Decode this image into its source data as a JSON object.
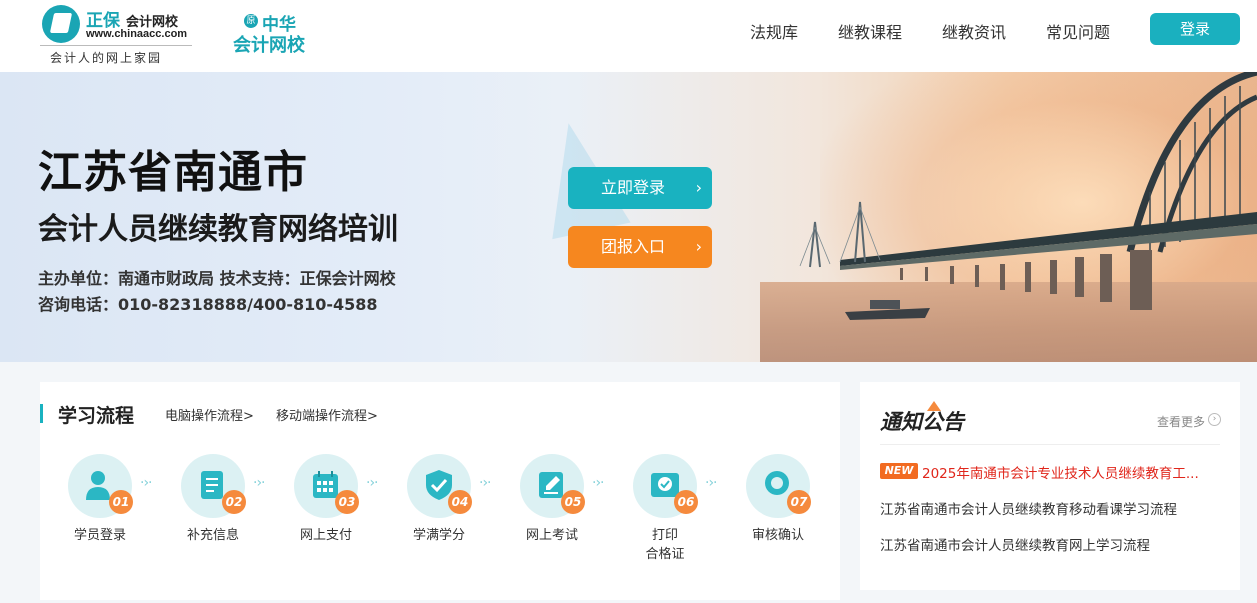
{
  "header": {
    "logo1": {
      "brand": "正保",
      "name": "会计网校",
      "url": "www.chinaacc.com",
      "slogan": "会计人的网上家园"
    },
    "logo2": {
      "badge": "原",
      "line1": "中华",
      "line2": "会计网校"
    },
    "nav": [
      "法规库",
      "继教课程",
      "继教资讯",
      "常见问题"
    ],
    "login_label": "登录"
  },
  "banner": {
    "title": "江苏省南通市",
    "subtitle": "会计人员继续教育网络培训",
    "organizer": "主办单位：南通市财政局  技术支持：正保会计网校",
    "hotline": "咨询电话：010-82318888/400-810-4588",
    "btn_login": "立即登录",
    "btn_group": "团报入口",
    "arrow": "›"
  },
  "process": {
    "title": "学习流程",
    "links": [
      "电脑操作流程>",
      "移动端操作流程>"
    ],
    "arrow": "·›·",
    "steps": [
      {
        "num": "01",
        "label": "学员登录",
        "icon": "user-icon"
      },
      {
        "num": "02",
        "label": "补充信息",
        "icon": "document-icon"
      },
      {
        "num": "03",
        "label": "网上支付",
        "icon": "calendar-icon"
      },
      {
        "num": "04",
        "label": "学满学分",
        "icon": "shield-check-icon"
      },
      {
        "num": "05",
        "label": "网上考试",
        "icon": "edit-icon"
      },
      {
        "num": "06",
        "label": "打印\n合格证",
        "icon": "certificate-icon"
      },
      {
        "num": "07",
        "label": "审核确认",
        "icon": "search-icon"
      }
    ]
  },
  "notice": {
    "title": "通知公告",
    "more": "查看更多",
    "new_badge": "NEW",
    "items": [
      "2025年南通市会计专业技术人员继续教育工...",
      "江苏省南通市会计人员继续教育移动看课学习流程",
      "江苏省南通市会计人员继续教育网上学习流程"
    ]
  },
  "colors": {
    "accent": "#19b2c0",
    "orange": "#f6871f",
    "new_red": "#e0261b"
  }
}
